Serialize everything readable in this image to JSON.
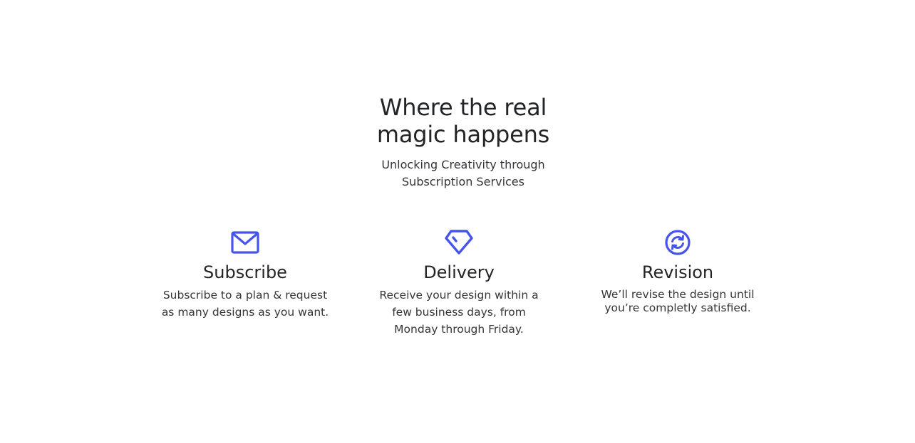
{
  "hero": {
    "title_lines": [
      "Where the real",
      "magic happens"
    ],
    "subtitle_lines": [
      "Unlocking Creativity through",
      "Subscription Services"
    ]
  },
  "features": [
    {
      "icon": "mail-icon",
      "title": "Subscribe",
      "desc_lines": [
        "Subscribe to a plan & request",
        "as many designs as you want."
      ]
    },
    {
      "icon": "diamond-icon",
      "title": "Delivery",
      "desc_lines": [
        "Receive your design within a",
        "few business days, from",
        "Monday through Friday."
      ]
    },
    {
      "icon": "refresh-icon",
      "title": "Revision",
      "desc_lines": [
        "We’ll  revise the design until",
        "you’re completly satisfied."
      ]
    }
  ],
  "colors": {
    "accent": "#4654ec",
    "text": "#222428"
  }
}
